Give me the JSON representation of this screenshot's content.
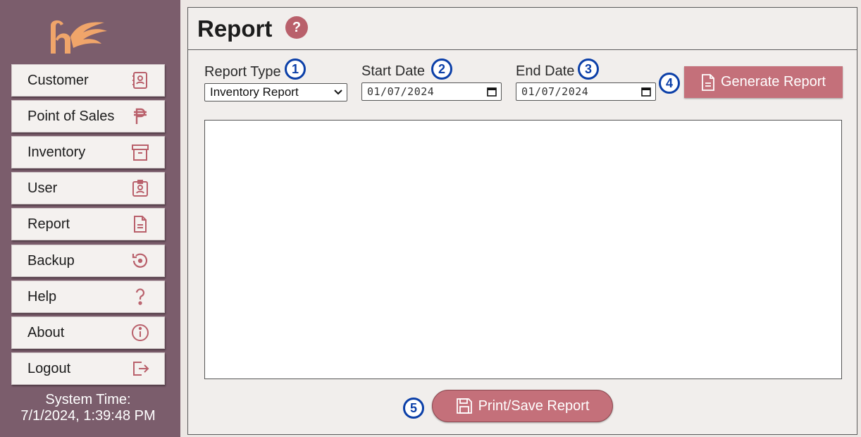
{
  "sidebar": {
    "items": [
      {
        "label": "Customer",
        "icon": "contact-book-icon"
      },
      {
        "label": "Point of Sales",
        "icon": "peso-icon"
      },
      {
        "label": "Inventory",
        "icon": "archive-box-icon"
      },
      {
        "label": "User",
        "icon": "user-badge-icon"
      },
      {
        "label": "Report",
        "icon": "document-icon"
      },
      {
        "label": "Backup",
        "icon": "restore-icon"
      },
      {
        "label": "Help",
        "icon": "question-mark-icon"
      },
      {
        "label": "About",
        "icon": "info-icon"
      },
      {
        "label": "Logout",
        "icon": "logout-icon"
      }
    ],
    "system_time_label": "System Time:",
    "system_time_value": "7/1/2024, 1:39:48 PM"
  },
  "header": {
    "title": "Report",
    "help_glyph": "?"
  },
  "form": {
    "report_type_label": "Report Type",
    "report_type_value": "Inventory Report",
    "start_date_label": "Start Date",
    "start_date_value": "01/07/2024",
    "end_date_label": "End Date",
    "end_date_value": "01/07/2024",
    "generate_label": "Generate Report",
    "print_label": "Print/Save Report"
  },
  "steps": [
    "1",
    "2",
    "3",
    "4",
    "5"
  ],
  "colors": {
    "sidebar_bg": "#7b5d6c",
    "accent": "#c4707a",
    "icon": "#b9606b",
    "step": "#0b3fa8"
  }
}
